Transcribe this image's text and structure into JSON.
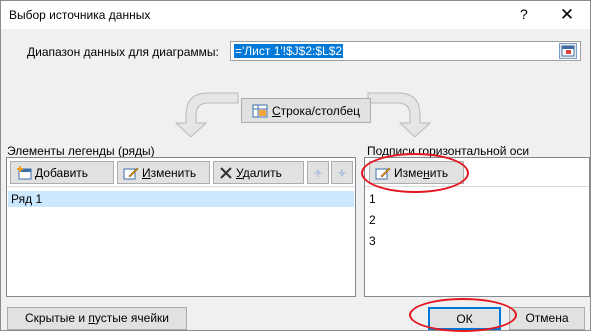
{
  "dialog": {
    "title": "Выбор источника данных",
    "help": "?",
    "close": "✕"
  },
  "range": {
    "label_pre": "",
    "label_ul": "Д",
    "label_post": "иапазон данных для диаграммы:",
    "value": "='Лист 1'!$J$2:$L$2"
  },
  "swap": {
    "label_ul": "С",
    "label_post": "трока/столбец"
  },
  "legend": {
    "label": "Элементы легенды (ряды)",
    "add_ul": "Д",
    "add_post": "обавить",
    "edit_ul": "И",
    "edit_post": "зменить",
    "delete_ul": "У",
    "delete_post": "далить",
    "items": [
      "Ряд 1"
    ]
  },
  "axis": {
    "label": "Подписи горизонтальной оси (категории)",
    "edit_pre": "Изме",
    "edit_ul": "н",
    "edit_post": "ить",
    "items": [
      "1",
      "2",
      "3"
    ]
  },
  "footer": {
    "hidden_pre": "Скрытые и ",
    "hidden_ul": "п",
    "hidden_post": "устые ячейки",
    "ok": "ОК",
    "cancel": "Отмена"
  },
  "colors": {
    "accent": "#0078d7",
    "highlight_circle": "#e4161f",
    "selection": "#cce8ff"
  }
}
